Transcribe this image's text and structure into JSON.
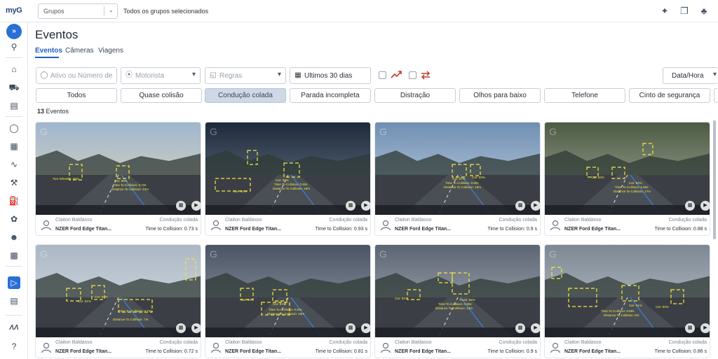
{
  "topbar": {
    "logo": "myG",
    "group_select_value": "Grupos",
    "group_status": "Todos os grupos selecionados",
    "icons": [
      "sparkle-icon",
      "windows-icon",
      "bell-icon"
    ]
  },
  "sidebar": {
    "toggle_label": "»",
    "items": [
      "search-icon",
      "home-icon",
      "truck-icon",
      "map-icon",
      "globe-icon",
      "report-icon",
      "route-icon",
      "wrench-icon",
      "fuel-icon",
      "leaf-icon",
      "users-icon",
      "puzzle-icon",
      "camera-icon",
      "document-icon",
      "brand-icon",
      "help-icon"
    ]
  },
  "page": {
    "title": "Eventos",
    "tabs": [
      "Eventos",
      "Câmeras",
      "Viagens"
    ]
  },
  "filters": {
    "asset_placeholder": "Ativo ou Número de",
    "driver_placeholder": "Motorista",
    "rules_placeholder": "Regras",
    "date_range": "Últimos 30 dias",
    "sort_label": "Data/Hora"
  },
  "chips": [
    "Todos",
    "Quase colisão",
    "Condução colada",
    "Parada incompleta",
    "Distração",
    "Olhos para baixo",
    "Telefone",
    "Cinto de segurança"
  ],
  "selected_chip": "Condução colada",
  "count": {
    "number": "13",
    "label": "Eventos"
  },
  "cards": [
    {
      "driver": "Claiton Baldasso",
      "vehicle": "NZER Ford Edge Titan...",
      "event": "Condução colada",
      "ttc": "Time to Collision: 0.73 s",
      "overlay": [
        "Two Wheeler: 66%",
        "Car: 96%",
        "Time To Collision: 0.73s",
        "Distance To Collision: 13m"
      ]
    },
    {
      "driver": "Claiton Baldasso",
      "vehicle": "NZER Ford Edge Titan...",
      "event": "Condução colada",
      "ttc": "Time to Collision: 0.93 s",
      "overlay": [
        "Car: 95%",
        "Car: 91%",
        "Time To Collision: 0.93s",
        "Distance To Collision: 18m"
      ]
    },
    {
      "driver": "Claiton Baldasso",
      "vehicle": "NZER Ford Edge Titan...",
      "event": "Condução colada",
      "ttc": "Time to Collision: 0.9 s",
      "overlay": [
        "Car: 87%",
        "Car: 93%",
        "Time To Collision: 0.90s",
        "Distance To Collision: 18m"
      ]
    },
    {
      "driver": "Claiton Baldasso",
      "vehicle": "NZER Ford Edge Titan...",
      "event": "Condução colada",
      "ttc": "Time to Collision: 0.88 s",
      "overlay": [
        "Car: 84%",
        "Car: 94%",
        "Time To Collision: 0.88s",
        "Distance To Collision: 17m"
      ]
    },
    {
      "driver": "Claiton Baldasso",
      "vehicle": "NZER Ford Edge Titan...",
      "event": "Condução colada",
      "ttc": "Time to Collision: 0.72 s",
      "overlay": [
        "Car: 91%",
        "Car: 83%",
        "Time To Collision: 0.72s",
        "Distance To Collision: 7m"
      ]
    },
    {
      "driver": "Claiton Baldasso",
      "vehicle": "NZER Ford Edge Titan...",
      "event": "Condução colada",
      "ttc": "Time to Collision: 0.81 s",
      "overlay": [
        "Car: 90%",
        "Car: 91%",
        "Time To Collision: 0.81s",
        "Distance To Collision: 19m"
      ]
    },
    {
      "driver": "Claiton Baldasso",
      "vehicle": "NZER Ford Edge Titan...",
      "event": "Condução colada",
      "ttc": "Time to Collision: 0.9 s",
      "overlay": [
        "Car: 91%",
        "Truck: 94%",
        "Time To Collision: 0.90s",
        "Distance To Collision: 13m"
      ]
    },
    {
      "driver": "Claiton Baldasso",
      "vehicle": "NZER Ford Edge Titan...",
      "event": "Condução colada",
      "ttc": "Time to Collision: 0.86 s",
      "overlay": [
        "Car: 91%",
        "Car: 94%",
        "Time To Collision: 0.86s",
        "Distance To Collision: 9m"
      ]
    }
  ]
}
